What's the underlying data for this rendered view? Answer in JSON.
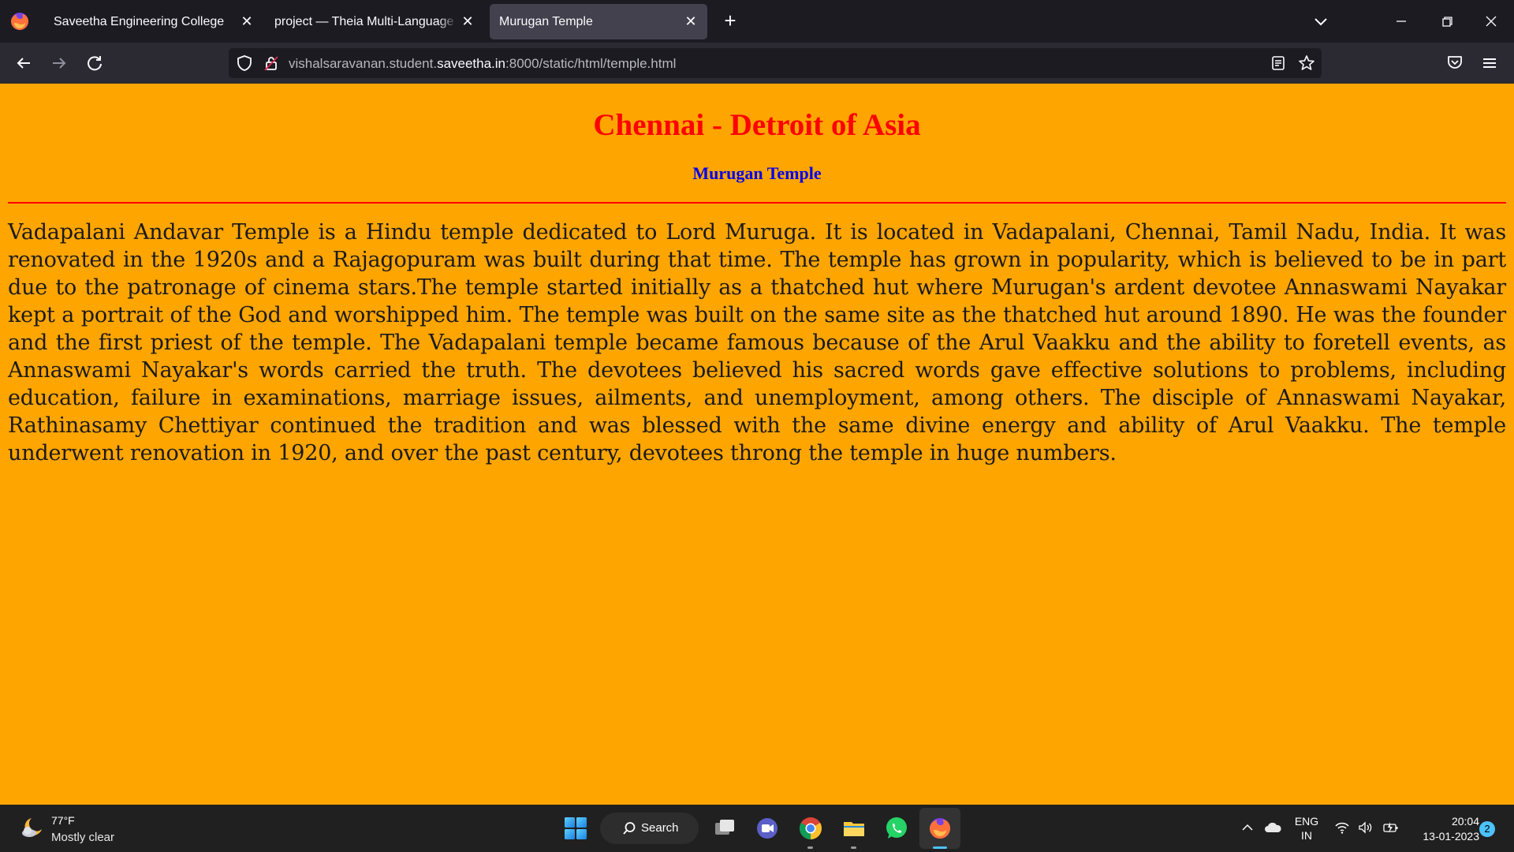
{
  "browser": {
    "tabs": [
      {
        "title": "Saveetha Engineering College",
        "active": false
      },
      {
        "title": "project — Theia Multi-Language Ex",
        "active": false
      },
      {
        "title": "Murugan Temple",
        "active": true
      }
    ],
    "url": {
      "prefix": "vishalsaravanan.student.",
      "host": "saveetha.in",
      "suffix": ":8000/static/html/temple.html"
    }
  },
  "page": {
    "background": "#ffa500",
    "title": "Chennai - Detroit of Asia",
    "title_color": "#ff0000",
    "subtitle": "Murugan Temple",
    "subtitle_color": "#0000ee",
    "rule_color": "#ff0000",
    "body": "Vadapalani Andavar Temple is a Hindu temple dedicated to Lord Muruga. It is located in Vadapalani, Chennai, Tamil Nadu, India. It was renovated in the 1920s and a Rajagopuram was built during that time. The temple has grown in popularity, which is believed to be in part due to the patronage of cinema stars.The temple started initially as a thatched hut where Murugan's ardent devotee Annaswami Nayakar kept a portrait of the God and worshipped him. The temple was built on the same site as the thatched hut around 1890. He was the founder and the first priest of the temple. The Vadapalani temple became famous because of the Arul Vaakku and the ability to foretell events, as Annaswami Nayakar's words carried the truth. The devotees believed his sacred words gave effective solutions to problems, including education, failure in examinations, marriage issues, ailments, and unemployment, among others. The disciple of Annaswami Nayakar, Rathinasamy Chettiyar continued the tradition and was blessed with the same divine energy and ability of Arul Vaakku. The temple underwent renovation in 1920, and over the past century, devotees throng the temple in huge numbers."
  },
  "taskbar": {
    "weather": {
      "temp": "77°F",
      "condition": "Mostly clear"
    },
    "search_label": "Search",
    "language": {
      "line1": "ENG",
      "line2": "IN"
    },
    "time": "20:04",
    "date": "13-01-2023",
    "notification_count": "2",
    "pinned_apps": [
      "task-view-icon",
      "teams-icon",
      "chrome-icon",
      "file-explorer-icon",
      "whatsapp-icon",
      "firefox-icon"
    ]
  }
}
